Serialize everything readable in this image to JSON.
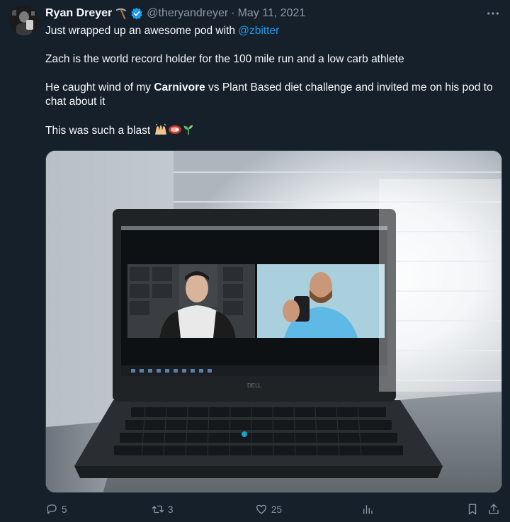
{
  "author": {
    "name": "Ryan Dreyer",
    "name_emoji_icon": "pickaxe-icon",
    "verified_icon": "verified-badge-icon",
    "handle": "@theryandreyer",
    "separator": "·",
    "date": "May 11, 2021"
  },
  "tweet": {
    "line1_prefix": "Just wrapped up an awesome pod with ",
    "line1_mention": "@zbitter",
    "line2": "Zach is the world record holder for the 100 mile run and a low carb athlete",
    "line3_prefix": "He caught wind of my ",
    "line3_bold": "Carnivore",
    "line3_suffix": " vs Plant Based diet challenge and invited me on his pod to chat about it",
    "line4": "This was such a blast",
    "line4_emojis": [
      "raising-hands-icon",
      "steak-icon",
      "seedling-icon"
    ]
  },
  "media": {
    "description_icon": "laptop-photo",
    "laptop_brand": "DELL"
  },
  "actions": {
    "reply_count": "5",
    "retweet_count": "3",
    "like_count": "25",
    "analytics_icon": "analytics-icon",
    "bookmark_icon": "bookmark-icon",
    "share_icon": "share-icon"
  },
  "colors": {
    "background": "#15202b",
    "text": "#f7f9f9",
    "muted": "#8b98a5",
    "accent": "#1d9bf0"
  }
}
